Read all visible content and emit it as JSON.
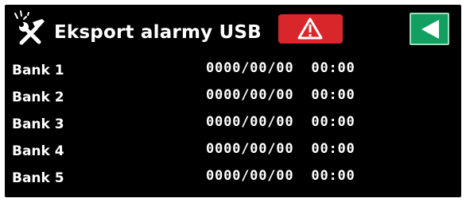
{
  "header": {
    "title": "Eksport alarmy USB",
    "icon": "tools-icon",
    "alarm_icon": "warning-triangle-icon",
    "back_icon": "back-arrow-icon"
  },
  "banks": [
    {
      "label": "Bank 1",
      "value": "0000/00/00  00:00"
    },
    {
      "label": "Bank 2",
      "value": "0000/00/00  00:00"
    },
    {
      "label": "Bank 3",
      "value": "0000/00/00  00:00"
    },
    {
      "label": "Bank 4",
      "value": "0000/00/00  00:00"
    },
    {
      "label": "Bank 5",
      "value": "0000/00/00  00:00"
    }
  ],
  "colors": {
    "background": "#000000",
    "text": "#ffffff",
    "alarm": "#d9262b",
    "back": "#12a062"
  }
}
